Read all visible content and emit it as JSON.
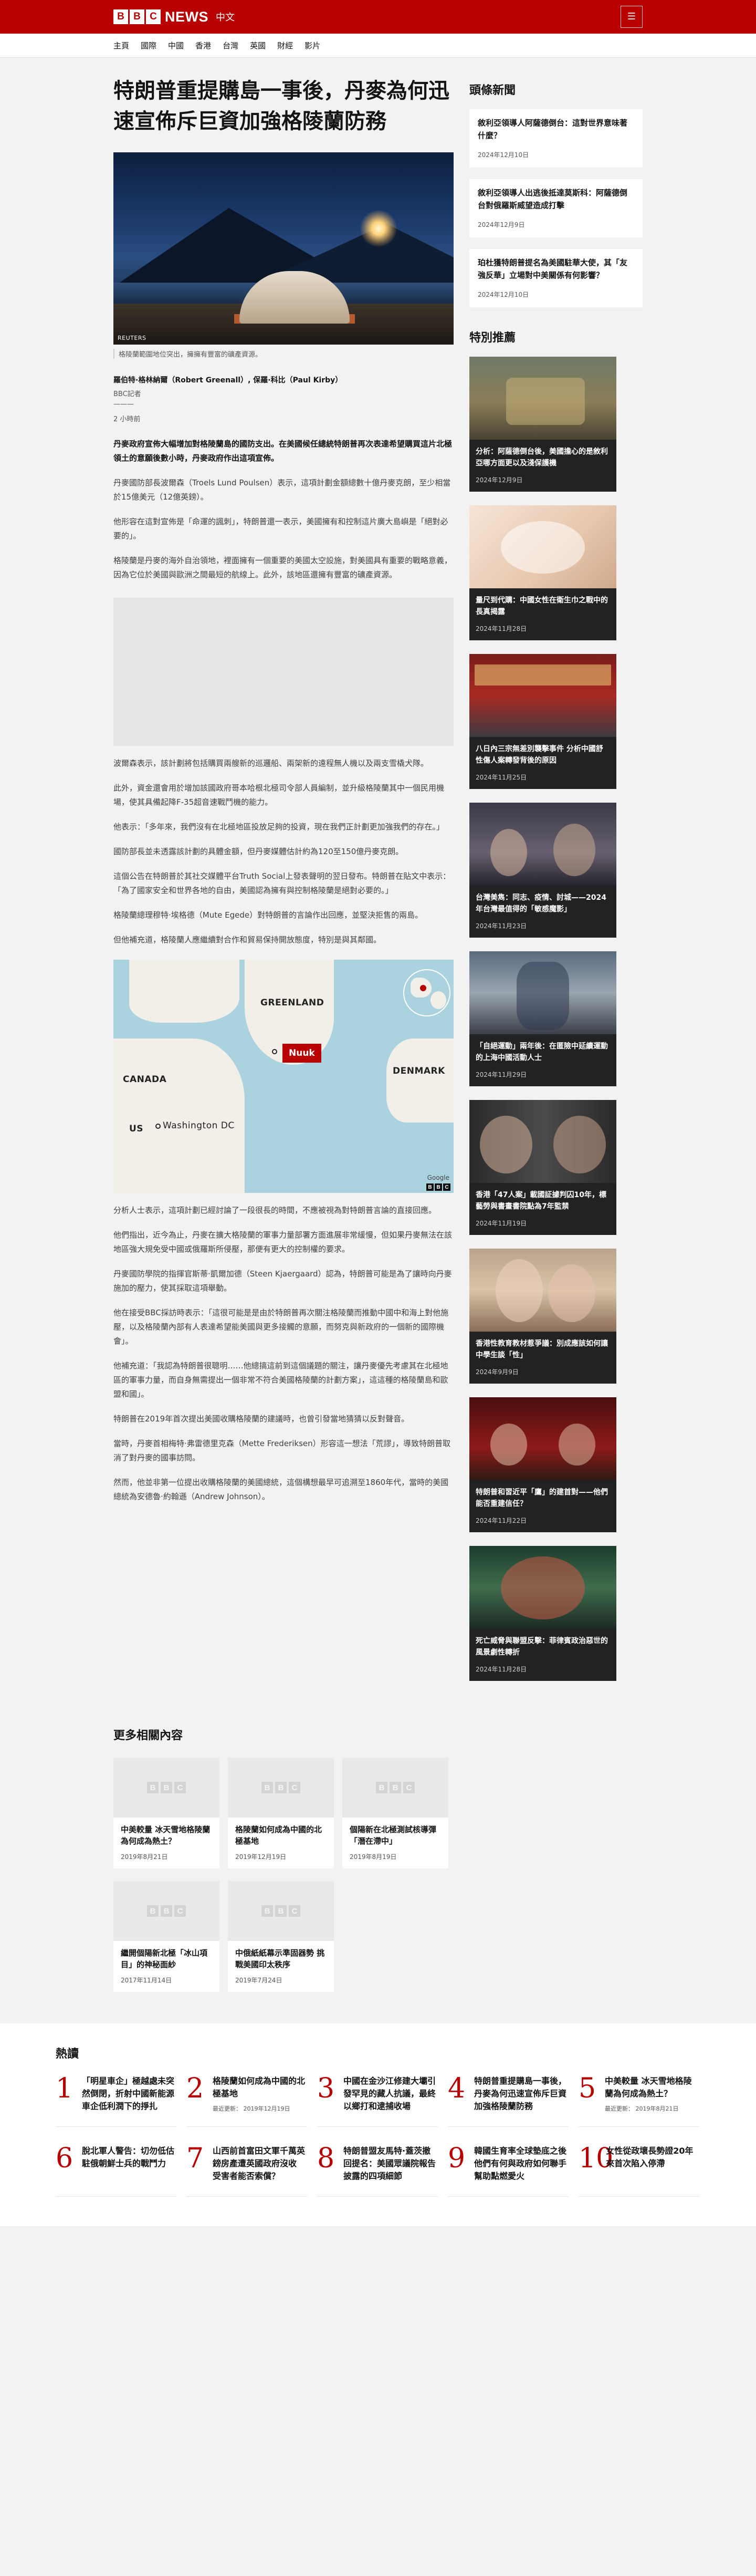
{
  "header": {
    "logo_letters": [
      "B",
      "B",
      "C"
    ],
    "logo_news": "NEWS",
    "logo_lang": "中文",
    "menu_icon": "hamburger-icon"
  },
  "nav": [
    "主頁",
    "國際",
    "中國",
    "香港",
    "台灣",
    "英國",
    "財經",
    "影片"
  ],
  "article": {
    "headline": "特朗普重提購島一事後，丹麥為何迅速宣佈斥巨資加強格陵蘭防務",
    "hero_credit": "REUTERS",
    "caption": "格陵蘭範圍地位突出，擁擁有豐富的礦產資源。",
    "authors": "羅伯特·格林納爾（Robert Greenall）, 保羅·科比（Paul Kirby）",
    "role": "BBC記者",
    "dash": "———",
    "date": "2 小時前",
    "paragraphs": [
      "丹麥政府宣佈大幅增加對格陵蘭島的國防支出。在美國候任總統特朗普再次表達希望購買這片北極領土的意願後數小時，丹麥政府作出這項宣佈。",
      "丹麥國防部長波爾森（Troels Lund Poulsen）表示，這項計劃金額總數十億丹麥克朗，至少相當於15億美元（12億英鎊）。",
      "他形容在這對宣佈是「命運的諷刺」，特朗普還一表示，美國擁有和控制這片廣大島嶼是「絕對必要的」。",
      "格陵蘭是丹麥的海外自治領地，裡面擁有一個重要的美國太空設施，對美國具有重要的戰略意義，因為它位於美國與歐洲之間最短的航線上。此外，該地區還擁有豐富的礦產資源。"
    ],
    "paragraphs2": [
      "波爾森表示，該計劃將包括購買兩艘新的巡邏船、兩架新的遠程無人機以及兩支雪橇犬隊。",
      "此外，資金還會用於增加該國政府哥本哈根北極司令部人員編制，並升級格陵蘭其中一個民用機場，使其具備起降F-35超音速戰鬥機的能力。",
      "他表示：「多年來，我們沒有在北極地區投放足夠的投資，現在我們正計劃更加強我們的存在。」",
      "國防部長並未透露該計劃的具體金額，但丹麥媒體估計約為120至150億丹麥克朗。",
      "這個公告在特朗普於其社交媒體平台Truth Social上發表聲明的翌日發布。特朗普在貼文中表示：「為了國家安全和世界各地的自由，美國認為擁有與控制格陵蘭是絕對必要的。」",
      "格陵蘭總理穆特·埃格德（Mute Egede）對特朗普的言論作出回應，並堅決拒售的兩島。",
      "但他補充道，格陵蘭人應繼續對合作和貿易保持開放態度，特別是與其鄰國。"
    ],
    "map": {
      "labels": [
        "GREENLAND",
        "CANADA",
        "DENMARK",
        "US",
        "Washington DC"
      ],
      "nuuk": "Nuuk",
      "attribution": "Google",
      "badge_letters": [
        "B",
        "B",
        "C"
      ]
    },
    "paragraphs3": [
      "分析人士表示，這項計劃已經討論了一段很長的時間，不應被視為對特朗普言論的直接回應。",
      "他們指出，近今為止，丹麥在擴大格陵蘭的軍事力量部署方面進展非常緩慢，但如果丹麥無法在該地區強大規免受中國或俄羅斯所侵壓，那便有更大的控制權的要求。",
      "丹麥國防學院的指揮官斯蒂·凱爾加德（Steen Kjaergaard）認為，特朗普可能是為了讓時向丹麥施加的壓力，使其採取這項舉動。",
      "他在接受BBC採訪時表示：「這很可能是是由於特朗普再次關注格陵蘭而推動中國中和海上對他施壓，以及格陵蘭內部有人表達希望能美國與更多接觸的意願，而努克與新政府的一個新的國際機會」。",
      "他補充道：「我認為特朗普很聰明……他總搞這前到這個議題的關注，讓丹麥優先考慮其在北極地區的軍事力量，而自身無需提出一個非常不符合美國格陵蘭的計劃方案」，這這種的格陵蘭島和歐盟和國」。",
      "特朗普在2019年首次提出美國收購格陵蘭的建議時，也曾引發當地猜猜以反對聲音。",
      "當時，丹麥首相梅特·弗雷德里克森（Mette Frederiksen）形容這一想法「荒謬」，導致特朗普取消了對丹麥的國事訪問。",
      "然而，他並非第一位提出收購格陵蘭的美國總統，這個構想最早可追溯至1860年代，當時的美國總統為安德魯·約翰遜（Andrew Johnson）。"
    ]
  },
  "sidebar": {
    "top_title": "頭條新聞",
    "top_news": [
      {
        "title": "敘利亞領導人阿薩德倒台：這對世界意味著什麼？",
        "date": "2024年12月10日"
      },
      {
        "title": "敘利亞領導人出逃後抵達莫斯科：阿薩德倒台對俄羅斯威望造成打擊",
        "date": "2024年12月9日"
      },
      {
        "title": "珀杜獲特朗普提名為美國駐華大使，其「友強反華」立場對中美關係有何影響？",
        "date": "2024年12月10日"
      }
    ],
    "feature_title": "特別推薦",
    "features": [
      {
        "title": "分析：阿薩德倒台後，美國擔心的是敘利亞哪方面更以及淺保護機",
        "date": "2024年12月9日",
        "icon": "feature-image"
      },
      {
        "title": "量尺到代購：中國女性在衛生巾之戰中的長真揭露",
        "date": "2024年11月28日",
        "icon": "feature-image"
      },
      {
        "title": "八日內三宗無差別襲擊事件 分析中國舒性傷人案轉發背後的原因",
        "date": "2024年11月25日",
        "icon": "feature-image"
      },
      {
        "title": "台灣美雋：同志、疫情、討城——2024年台灣最值得的「敏感魔影」",
        "date": "2024年11月23日",
        "icon": "feature-image"
      },
      {
        "title": "「自絕運動」兩年後：在匿險中延續運動的上海中國活動人士",
        "date": "2024年11月29日",
        "icon": "feature-image"
      },
      {
        "title": "香港「47人案」載國証據判囚10年，標藝勞與書畫書院點為7年監禁",
        "date": "2024年11月19日",
        "icon": "feature-image"
      },
      {
        "title": "香港性教育教材惹爭議：別成應該如何讓中學生談「性」",
        "date": "2024年9月9日",
        "icon": "feature-image"
      },
      {
        "title": "特朗普和習近平「鷹」的建首對——他們能否重建信任？",
        "date": "2024年11月22日",
        "icon": "feature-image"
      },
      {
        "title": "死亡威脅與聯盟反擊：菲律賓政治惡世的風景劇性轉折",
        "date": "2024年11月28日",
        "icon": "feature-image"
      }
    ]
  },
  "related": {
    "title": "更多相關內容",
    "items": [
      {
        "title": "中美較量 冰天雪地格陵蘭為何成為熱土？",
        "date": "2019年8月21日"
      },
      {
        "title": "格陵蘭如何成為中國的北極基地",
        "date": "2019年12月19日"
      },
      {
        "title": "個陽新在北極測試核導彈「潛在滯中」",
        "date": "2019年8月19日"
      },
      {
        "title": "繼開個陽新北極「冰山項目」的神秘面紗",
        "date": "2017年11月14日"
      },
      {
        "title": "中俄紙紙幕示準固器勢 挑戰美國印太秩序",
        "date": "2019年7月24日"
      }
    ]
  },
  "mostread": {
    "title": "熱讀",
    "items": [
      {
        "num": "1",
        "title": "「明星車企」極越處未突然倒閉，折射中國新能源車企低利潤下的掙扎",
        "date": ""
      },
      {
        "num": "2",
        "title": "格陵蘭如何成為中國的北極基地",
        "date": "最近更新： 2019年12月19日"
      },
      {
        "num": "3",
        "title": "中國在金沙江修建大壩引發罕見的藏人抗議，最終以鄉打和逮捕收場",
        "date": ""
      },
      {
        "num": "4",
        "title": "特朗普重提購島一事後，丹麥為何迅速宣佈斥巨資加強格陵蘭防務",
        "date": ""
      },
      {
        "num": "5",
        "title": "中美較量 冰天雪地格陵蘭為何成為熱土？",
        "date": "最近更新： 2019年8月21日"
      },
      {
        "num": "6",
        "title": "脫北軍人警告：切勿低估駐俄朝鮮士兵的戰鬥力",
        "date": ""
      },
      {
        "num": "7",
        "title": "山西前首富田文軍千萬英鎊房產遭英國政府沒收 受害者能否索償？",
        "date": ""
      },
      {
        "num": "8",
        "title": "特朗普盟友馬特·蓋茨撤回提名：美國眾議院報告披露的四項細節",
        "date": ""
      },
      {
        "num": "9",
        "title": "韓國生育率全球墊底之後 他們有何與政府如何聯手幫助點燃愛火",
        "date": ""
      },
      {
        "num": "10",
        "title": "女性從政壞長勢證20年來首次陷入停滯",
        "date": ""
      }
    ]
  },
  "colors": {
    "brand_red": "#b80000",
    "page_bg": "#f2f2f2",
    "text": "#141414"
  }
}
